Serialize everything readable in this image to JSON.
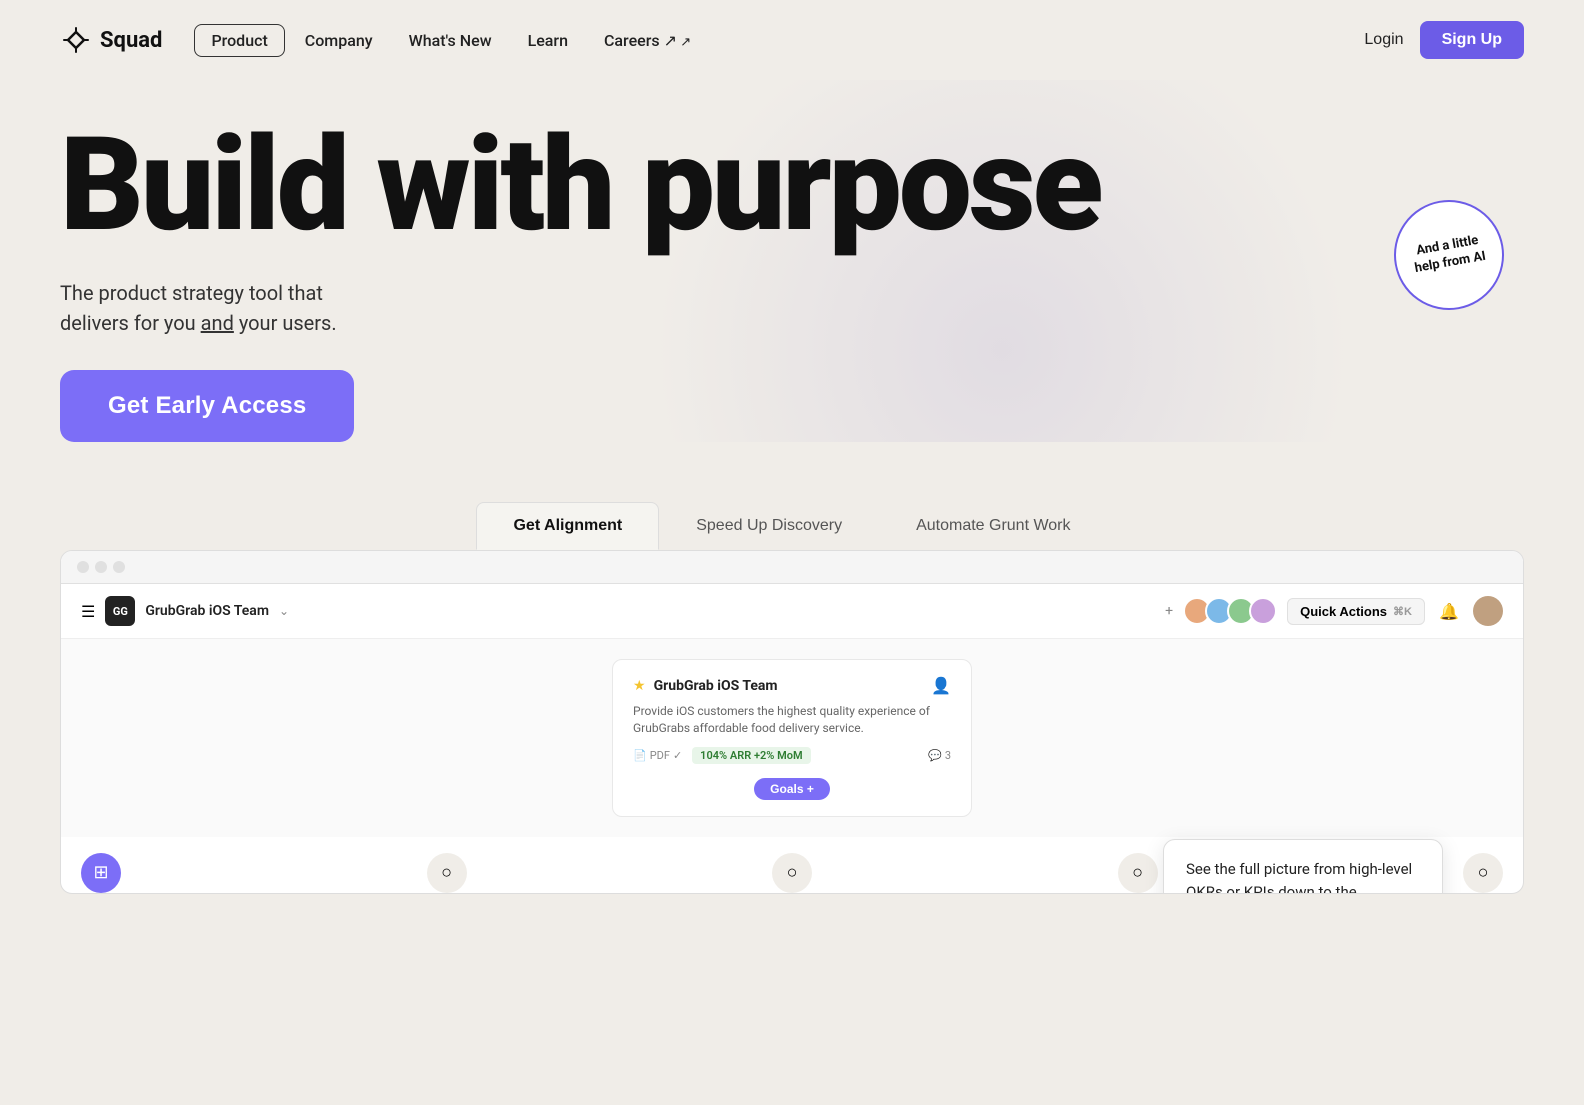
{
  "nav": {
    "logo_text": "Squad",
    "links": [
      {
        "label": "Product",
        "active": true,
        "has_arrow": false
      },
      {
        "label": "Company",
        "active": false,
        "has_arrow": false
      },
      {
        "label": "What's New",
        "active": false,
        "has_arrow": false
      },
      {
        "label": "Learn",
        "active": false,
        "has_arrow": false
      },
      {
        "label": "Careers ↗",
        "active": false,
        "has_arrow": false
      }
    ],
    "login_label": "Login",
    "signup_label": "Sign Up"
  },
  "hero": {
    "heading": "Build with purpose",
    "subheading_part1": "The product strategy tool that",
    "subheading_part2": "delivers for you",
    "subheading_and": "and",
    "subheading_part3": "your users.",
    "cta_label": "Get Early Access",
    "ai_badge_line1": "And a little",
    "ai_badge_line2": "help from AI"
  },
  "tabs": [
    {
      "label": "Get Alignment",
      "active": true
    },
    {
      "label": "Speed Up Discovery",
      "active": false
    },
    {
      "label": "Automate Grunt Work",
      "active": false
    }
  ],
  "browser": {
    "app_bar": {
      "team_name": "GrubGrab iOS Team",
      "quick_actions_label": "Quick Actions",
      "quick_actions_shortcut": "K"
    },
    "project_card": {
      "title": "GrubGrab iOS Team",
      "description": "Provide iOS customers the highest quality experience of GrubGrabs affordable food delivery service.",
      "pdf_label": "PDF",
      "arr_label": "104% ARR",
      "arr_delta": "+2% MoM",
      "goals_label": "Goals +"
    },
    "tooltip": {
      "text": "See the full picture from high-level OKRs or KPIs down to the individual solutions being implemented."
    }
  },
  "colors": {
    "accent": "#7c6ef7",
    "accent_dark": "#6c5ce7",
    "bg": "#f0ede8"
  }
}
